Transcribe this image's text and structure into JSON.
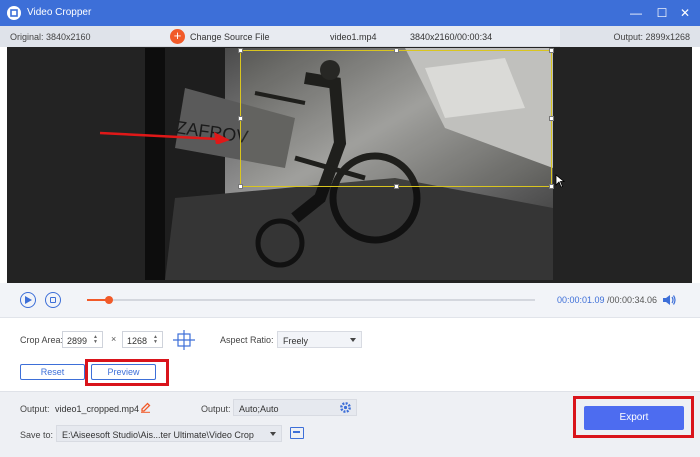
{
  "window": {
    "title": "Video Cropper",
    "controls": {
      "minimize": "—",
      "maximize": "☐",
      "close": "✕"
    }
  },
  "infobar": {
    "original": "Original: 3840x2160",
    "change_source": "Change Source File",
    "filename": "video1.mp4",
    "resolution_duration": "3840x2160/00:00:34",
    "output": "Output: 2899x1268"
  },
  "player": {
    "current_time": "00:00:01.09",
    "total_time": "/00:00:34.06",
    "progress": 0.05
  },
  "crop": {
    "crop_area_label": "Crop Area:",
    "width": "2899",
    "times": "×",
    "height": "1268",
    "aspect_ratio_label": "Aspect Ratio:",
    "aspect_ratio_value": "Freely"
  },
  "actions": {
    "reset_label": "Reset",
    "preview_label": "Preview",
    "export_label": "Export"
  },
  "output": {
    "output_label": "Output:",
    "output_file": "video1_cropped.mp4",
    "format_label": "Output:",
    "format_value": "Auto;Auto",
    "save_to_label": "Save to:",
    "save_path": "E:\\Aiseesoft Studio\\Ais...ter Ultimate\\Video Crop"
  },
  "colors": {
    "accent": "#3d6fd8",
    "titlebar": "#3d6fd8",
    "progress": "#f15a29",
    "crop_border": "#d9c51f",
    "annotation_red": "#d9141b",
    "export_button": "#4d6cf0"
  },
  "icons": [
    "app-logo-icon",
    "minimize-icon",
    "maximize-icon",
    "close-icon",
    "add-icon",
    "play-icon",
    "stop-icon",
    "volume-icon",
    "center-crop-icon",
    "edit-icon",
    "gear-icon",
    "folder-icon",
    "red-arrow-icon",
    "cursor-icon"
  ]
}
